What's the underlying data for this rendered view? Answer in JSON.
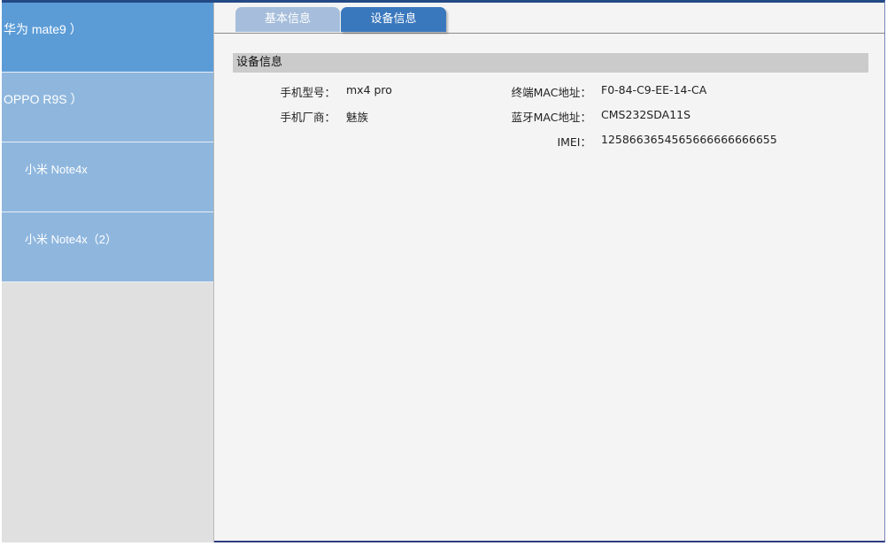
{
  "sidebar": {
    "items": [
      {
        "label": "华为 mate9 ）"
      },
      {
        "label": "OPPO R9S ）"
      },
      {
        "label": "小米 Note4x"
      },
      {
        "label": "小米 Note4x（2）"
      }
    ]
  },
  "tabs": {
    "basic_label": "基本信息",
    "device_label": "设备信息"
  },
  "section": {
    "title": "设备信息"
  },
  "fields": {
    "model_label": "手机型号：",
    "model_value": "mx4 pro",
    "maker_label": "手机厂商：",
    "maker_value": "魅族",
    "mac_label": "终端MAC地址：",
    "mac_value": "F0-84-C9-EE-14-CA",
    "bt_label": "蓝牙MAC地址：",
    "bt_value": "CMS232SDA11S",
    "imei_label": "IMEI：",
    "imei_value": "1258663654565666666666655"
  },
  "colors": {
    "active_item": "#5b9cd7",
    "inactive_item": "#8fb7de",
    "active_tab": "#3a78bd",
    "inactive_tab": "#a6bedb",
    "section_header": "#cbcbcb"
  }
}
